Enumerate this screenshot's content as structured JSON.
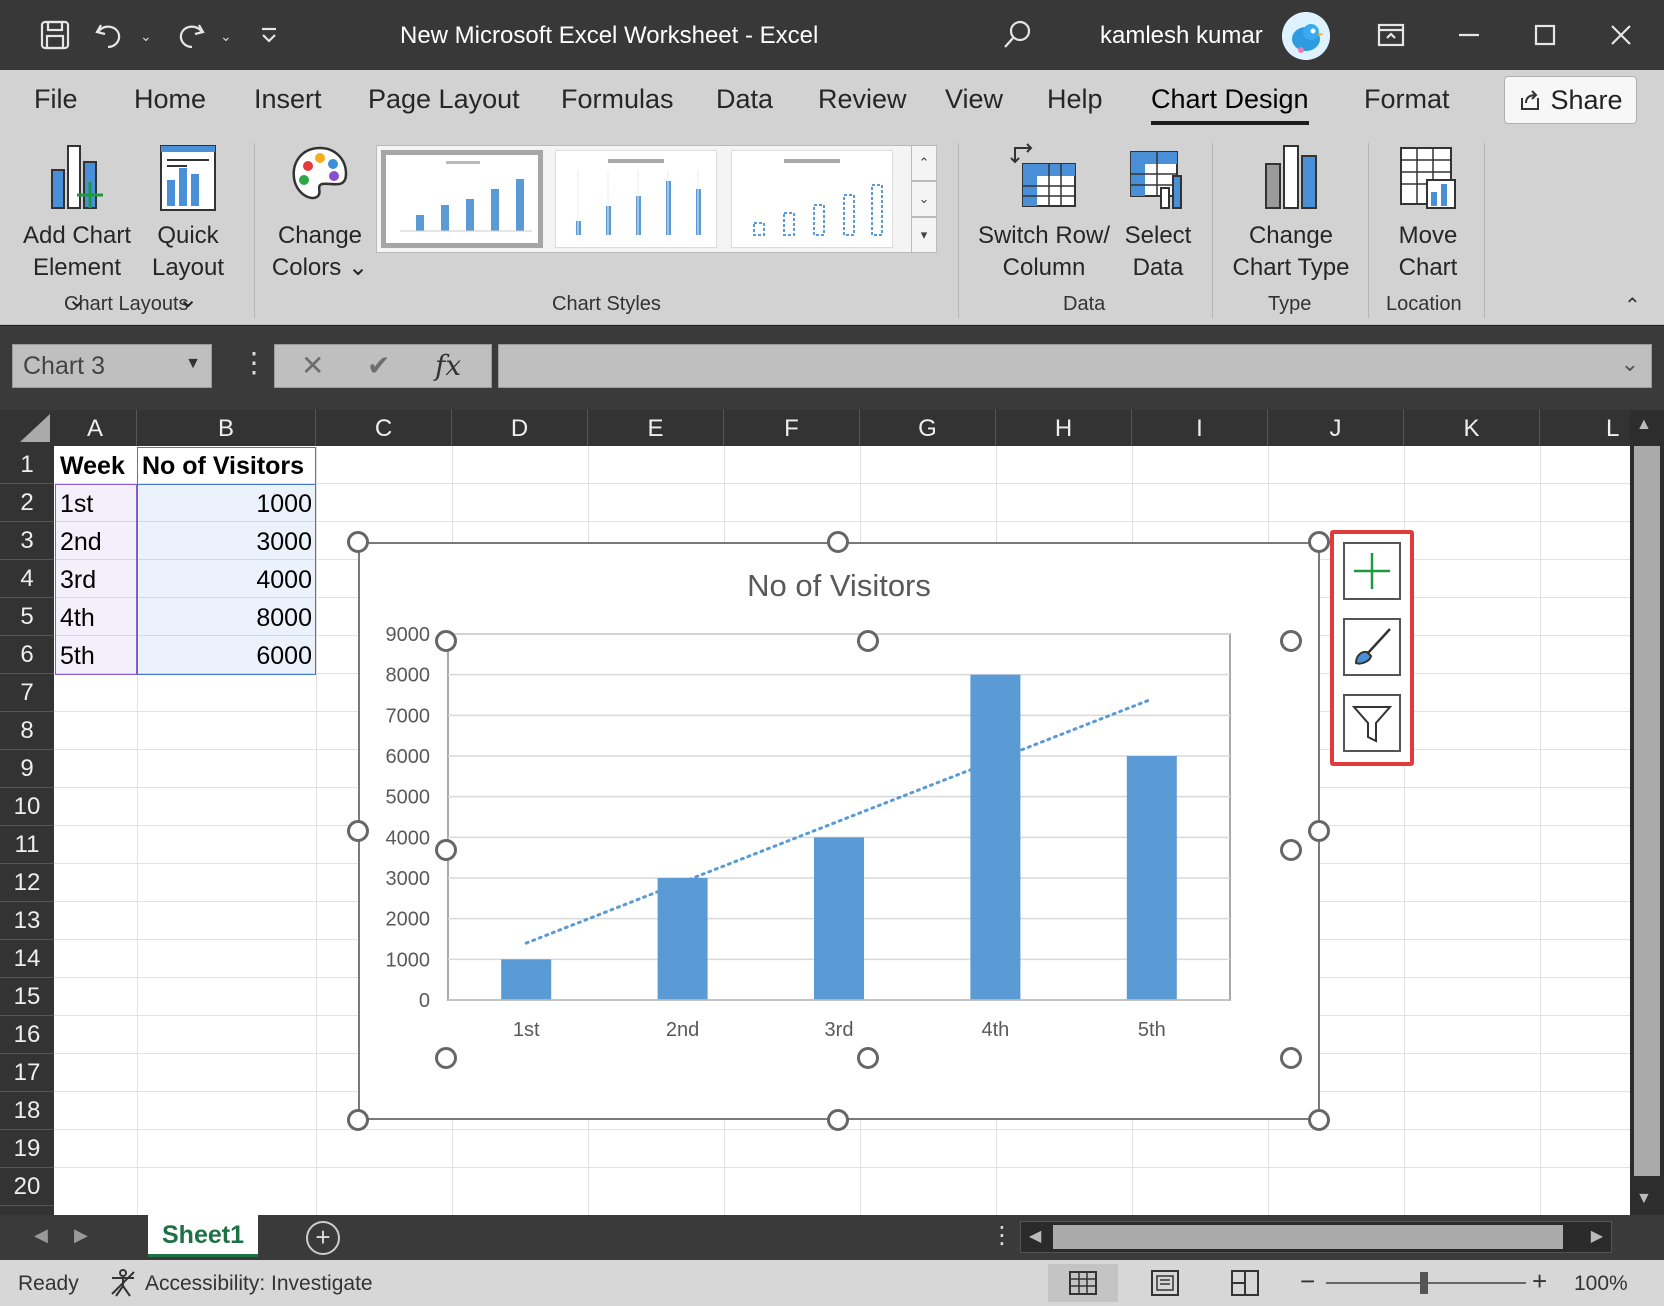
{
  "window": {
    "title": "New Microsoft Excel Worksheet  -  Excel",
    "user": "kamlesh kumar"
  },
  "ribbon": {
    "tabs": [
      "File",
      "Home",
      "Insert",
      "Page Layout",
      "Formulas",
      "Data",
      "Review",
      "View",
      "Help",
      "Chart Design",
      "Format"
    ],
    "active_tab": "Chart Design",
    "share_label": "Share",
    "buttons": {
      "add_chart_element": [
        "Add Chart",
        "Element ⌄"
      ],
      "quick_layout": [
        "Quick",
        "Layout ⌄"
      ],
      "change_colors": [
        "Change",
        "Colors ⌄"
      ],
      "switch_row_column": [
        "Switch Row/",
        "Column"
      ],
      "select_data": [
        "Select",
        "Data"
      ],
      "change_chart_type": [
        "Change",
        "Chart Type"
      ],
      "move_chart": [
        "Move",
        "Chart"
      ]
    },
    "groups": {
      "chart_layouts": "Chart Layouts",
      "chart_styles": "Chart Styles",
      "data": "Data",
      "type": "Type",
      "location": "Location"
    }
  },
  "formula_bar": {
    "name_box": "Chart 3",
    "fx": "fx",
    "cancel": "✕",
    "enter": "✔",
    "formula": ""
  },
  "sheet": {
    "columns": [
      "A",
      "B",
      "C",
      "D",
      "E",
      "F",
      "G",
      "H",
      "I",
      "J",
      "K",
      "L"
    ],
    "rows": [
      "1",
      "2",
      "3",
      "4",
      "5",
      "6",
      "7",
      "8",
      "9",
      "10",
      "11",
      "12",
      "13",
      "14",
      "15",
      "16",
      "17",
      "18",
      "19",
      "20"
    ],
    "headers": [
      "Week",
      "No of Visitors"
    ],
    "data": [
      [
        "1st",
        "1000"
      ],
      [
        "2nd",
        "3000"
      ],
      [
        "3rd",
        "4000"
      ],
      [
        "4th",
        "8000"
      ],
      [
        "5th",
        "6000"
      ]
    ]
  },
  "chart_data": {
    "type": "bar",
    "title": "No of Visitors",
    "categories": [
      "1st",
      "2nd",
      "3rd",
      "4th",
      "5th"
    ],
    "series": [
      {
        "name": "No of Visitors",
        "values": [
          1000,
          3000,
          4000,
          8000,
          6000
        ],
        "color": "#5b9bd5"
      }
    ],
    "trendline": {
      "type": "linear",
      "style": "dotted",
      "color": "#5b9bd5"
    },
    "ylim": [
      0,
      9000
    ],
    "yticks": [
      0,
      1000,
      2000,
      3000,
      4000,
      5000,
      6000,
      7000,
      8000,
      9000
    ],
    "grid": true,
    "legend": "none",
    "xlabel": "",
    "ylabel": ""
  },
  "sheets": {
    "tabs": [
      "Sheet1"
    ],
    "active": "Sheet1"
  },
  "status": {
    "mode": "Ready",
    "accessibility": "Accessibility: Investigate",
    "zoom": "100%"
  },
  "colors": {
    "accent_green": "#1e7145",
    "highlight_red": "#e03c3c",
    "bar_blue": "#5b9bd5"
  }
}
